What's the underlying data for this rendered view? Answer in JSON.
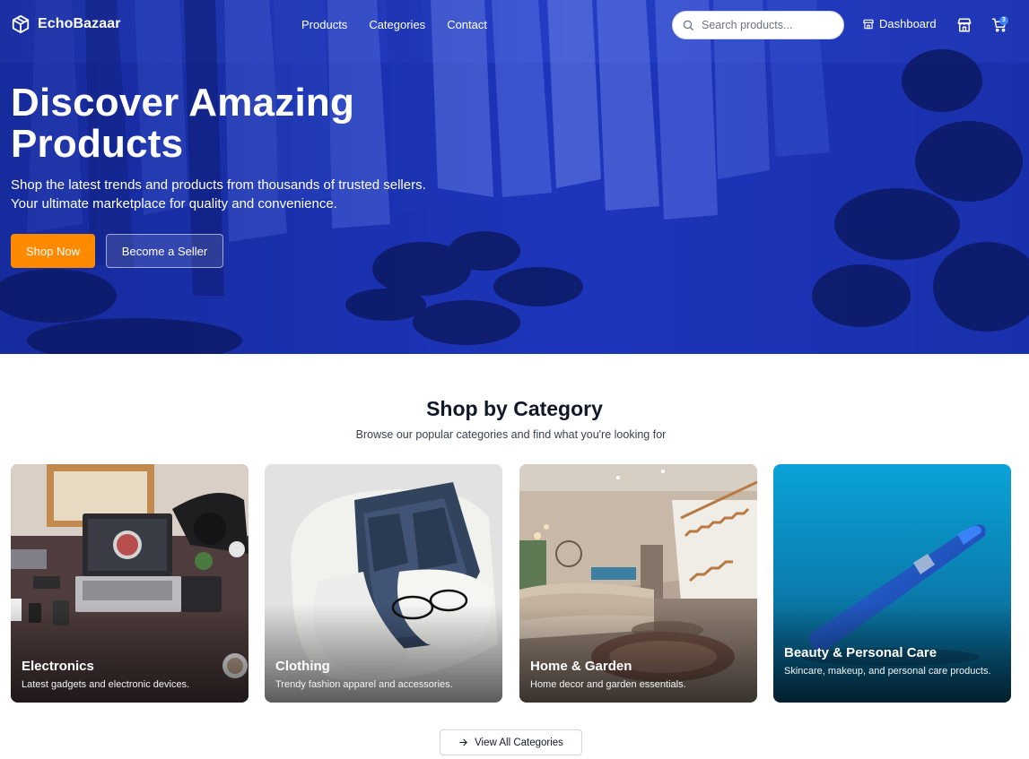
{
  "brand": {
    "name": "EchoBazaar",
    "icon": "box-icon"
  },
  "nav": {
    "links": [
      "Products",
      "Categories",
      "Contact"
    ],
    "search_placeholder": "Search products...",
    "dashboard_label": "Dashboard",
    "cart_count": "3"
  },
  "hero": {
    "title": "Discover Amazing Products",
    "subtitle_line1": "Shop the latest trends and products from thousands of trusted sellers.",
    "subtitle_line2": "Your ultimate marketplace for quality and convenience.",
    "primary_button": "Shop Now",
    "secondary_button": "Become a Seller"
  },
  "categories": {
    "title": "Shop by Category",
    "subtitle": "Browse our popular categories and find what you're looking for",
    "items": [
      {
        "name": "Electronics",
        "description": "Latest gadgets and electronic devices."
      },
      {
        "name": "Clothing",
        "description": "Trendy fashion apparel and accessories."
      },
      {
        "name": "Home & Garden",
        "description": "Home decor and garden essentials."
      },
      {
        "name": "Beauty & Personal Care",
        "description": "Skincare, makeup, and personal care products."
      }
    ],
    "view_all_label": "View All Categories"
  },
  "colors": {
    "hero_blue": "#1e38c4",
    "accent_orange": "#ff8a00",
    "cart_badge": "#3b82f6"
  }
}
